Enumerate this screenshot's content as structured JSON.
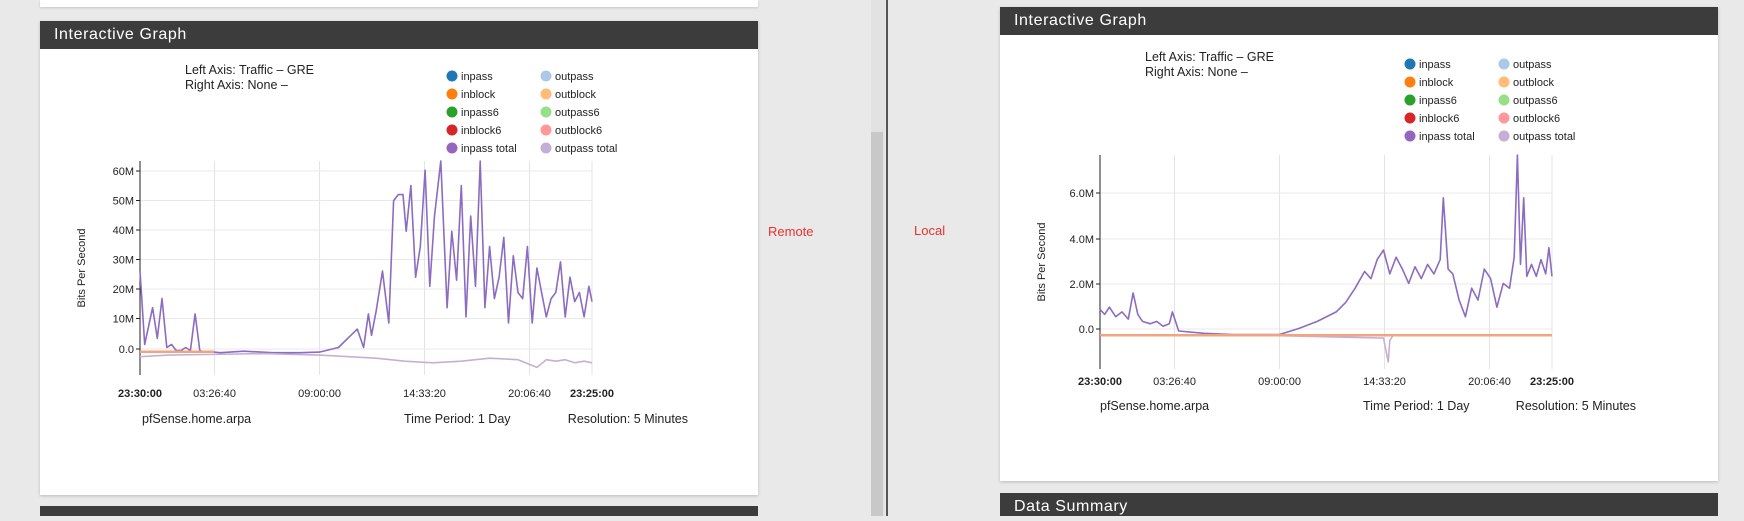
{
  "labels": {
    "remote": "Remote",
    "local": "Local"
  },
  "bottom_panels": {
    "right_title": "Data Summary"
  },
  "legend_items": [
    {
      "name": "inpass",
      "color": "#1f77b4"
    },
    {
      "name": "outpass",
      "color": "#aec7e8"
    },
    {
      "name": "inblock",
      "color": "#ff7f0e"
    },
    {
      "name": "outblock",
      "color": "#ffbb78"
    },
    {
      "name": "inpass6",
      "color": "#2ca02c"
    },
    {
      "name": "outpass6",
      "color": "#98df8a"
    },
    {
      "name": "inblock6",
      "color": "#d62728"
    },
    {
      "name": "outblock6",
      "color": "#ff9896"
    },
    {
      "name": "inpass total",
      "color": "#9467bd"
    },
    {
      "name": "outpass total",
      "color": "#c5b0d5"
    }
  ],
  "chart_data": [
    {
      "type": "line",
      "panel_title": "Interactive Graph",
      "left_axis": "Left Axis: Traffic – GRE",
      "right_axis": "Right Axis: None –",
      "ylabel": "Bits Per Second",
      "y_ticks": [
        "60M",
        "50M",
        "40M",
        "30M",
        "20M",
        "10M",
        "0.0"
      ],
      "ylim": [
        -7,
        63
      ],
      "x_ticks": [
        "23:30:00",
        "03:26:40",
        "09:00:00",
        "14:33:20",
        "20:06:40",
        "23:25:00"
      ],
      "x_ticks_bold": [
        true,
        false,
        false,
        false,
        false,
        true
      ],
      "xlim": [
        "23:30:00",
        "23:25:00"
      ],
      "grid": true,
      "legend_position": "top-right",
      "host": "pfSense.home.arpa",
      "time_period": "Time Period: 1 Day",
      "resolution": "Resolution: 5 Minutes",
      "series": [
        {
          "name": "inpass total",
          "color": "#8b6cc1",
          "x": [
            "23:30",
            "23:45",
            "00:10",
            "00:25",
            "00:40",
            "00:55",
            "01:10",
            "01:25",
            "01:40",
            "01:55",
            "02:10",
            "02:25",
            "02:40",
            "02:55",
            "03:10",
            "03:25",
            "03:45",
            "05:00",
            "06:30",
            "08:00",
            "09:00",
            "10:00",
            "11:00",
            "11:20",
            "11:35",
            "11:45",
            "12:00",
            "12:20",
            "12:40",
            "12:55",
            "13:10",
            "13:25",
            "13:35",
            "13:50",
            "14:05",
            "14:20",
            "14:35",
            "14:50",
            "15:05",
            "15:25",
            "15:45",
            "16:00",
            "16:15",
            "16:30",
            "16:45",
            "17:00",
            "17:15",
            "17:30",
            "17:45",
            "18:00",
            "18:15",
            "18:30",
            "18:45",
            "19:00",
            "19:15",
            "19:30",
            "19:45",
            "20:00",
            "20:15",
            "20:30",
            "20:45",
            "21:00",
            "21:15",
            "21:30",
            "21:45",
            "22:00",
            "22:15",
            "22:30",
            "22:45",
            "23:00",
            "23:15",
            "23:25"
          ],
          "y": [
            27,
            3,
            15,
            5,
            18,
            2,
            3,
            1,
            1,
            2,
            1,
            13,
            1,
            0.5,
            0.5,
            0.5,
            0.3,
            0.8,
            0.3,
            0.3,
            0.5,
            2,
            8,
            2,
            13,
            6,
            14,
            27,
            10,
            50,
            52,
            52,
            40,
            55,
            25,
            35,
            60,
            22,
            45,
            63,
            15,
            40,
            24,
            55,
            12,
            45,
            22,
            63,
            15,
            35,
            18,
            25,
            38,
            10,
            32,
            20,
            18,
            35,
            10,
            28,
            20,
            12,
            18,
            20,
            30,
            12,
            25,
            17,
            20,
            12,
            22,
            17
          ]
        },
        {
          "name": "outpass total",
          "color": "#c5b0d5",
          "x": [
            "23:30",
            "01:00",
            "03:00",
            "06:00",
            "09:00",
            "12:00",
            "13:30",
            "15:00",
            "16:30",
            "18:00",
            "19:30",
            "20:30",
            "21:00",
            "21:30",
            "22:00",
            "22:30",
            "23:00",
            "23:25"
          ],
          "y": [
            -1,
            -0.5,
            -0.3,
            0,
            -0.5,
            -1.5,
            -2.5,
            -3,
            -2.5,
            -1.5,
            -2,
            -4.5,
            -2,
            -2.5,
            -2,
            -3,
            -2.5,
            -3
          ]
        },
        {
          "name": "inblock",
          "color": "#f2a480",
          "x": [
            "23:30",
            "03:25"
          ],
          "y": [
            0.6,
            0.6
          ]
        }
      ]
    },
    {
      "type": "line",
      "panel_title": "Interactive Graph",
      "left_axis": "Left Axis: Traffic – GRE",
      "right_axis": "Right Axis: None –",
      "ylabel": "Bits Per Second",
      "y_ticks": [
        "6.0M",
        "4.0M",
        "2.0M",
        "0.0"
      ],
      "ylim": [
        -1.4,
        7.6
      ],
      "x_ticks": [
        "23:30:00",
        "03:26:40",
        "09:00:00",
        "14:33:20",
        "20:06:40",
        "23:25:00"
      ],
      "x_ticks_bold": [
        true,
        false,
        false,
        false,
        false,
        true
      ],
      "xlim": [
        "23:30:00",
        "23:25:00"
      ],
      "grid": true,
      "legend_position": "top-right",
      "host": "pfSense.home.arpa",
      "time_period": "Time Period: 1 Day",
      "resolution": "Resolution: 5 Minutes",
      "series": [
        {
          "name": "inpass total",
          "color": "#8b6cc1",
          "x": [
            "23:30",
            "23:45",
            "00:00",
            "00:20",
            "00:40",
            "01:00",
            "01:15",
            "01:30",
            "01:45",
            "02:10",
            "02:30",
            "02:50",
            "03:10",
            "03:20",
            "03:40",
            "05:00",
            "06:30",
            "08:00",
            "09:00",
            "10:00",
            "11:00",
            "12:00",
            "12:30",
            "13:00",
            "13:30",
            "13:50",
            "14:10",
            "14:30",
            "14:50",
            "15:10",
            "15:30",
            "15:50",
            "16:10",
            "16:30",
            "16:50",
            "17:10",
            "17:30",
            "17:40",
            "17:55",
            "18:10",
            "18:30",
            "18:50",
            "19:10",
            "19:30",
            "19:50",
            "20:10",
            "20:30",
            "20:50",
            "21:10",
            "21:25",
            "21:35",
            "21:45",
            "21:55",
            "22:05",
            "22:20",
            "22:35",
            "22:50",
            "23:05",
            "23:15",
            "23:25"
          ],
          "y": [
            1.1,
            0.9,
            1.2,
            0.8,
            1.0,
            0.7,
            1.8,
            0.9,
            0.6,
            0.5,
            0.6,
            0.4,
            0.5,
            1.0,
            0.2,
            0.1,
            0.05,
            0.05,
            0.05,
            0.3,
            0.6,
            1.0,
            1.4,
            2.0,
            2.7,
            2.4,
            3.2,
            3.6,
            2.6,
            3.3,
            2.8,
            2.2,
            2.9,
            2.4,
            3.0,
            2.6,
            3.2,
            5.8,
            2.8,
            2.6,
            1.5,
            0.8,
            2.0,
            1.5,
            2.8,
            2.4,
            1.2,
            2.2,
            2.0,
            3.3,
            7.6,
            3.0,
            5.8,
            2.5,
            3.0,
            2.5,
            3.2,
            2.6,
            3.7,
            2.5
          ]
        },
        {
          "name": "outpass total",
          "color": "#c5b0d5",
          "x": [
            "23:30",
            "09:00",
            "14:30",
            "14:45",
            "14:50",
            "15:00",
            "23:25"
          ],
          "y": [
            0,
            0,
            -0.1,
            -1.1,
            -0.2,
            0,
            0
          ]
        },
        {
          "name": "inblock",
          "color": "#f2a480",
          "x": [
            "23:30",
            "23:25"
          ],
          "y": [
            0.02,
            0.02
          ]
        }
      ]
    }
  ]
}
